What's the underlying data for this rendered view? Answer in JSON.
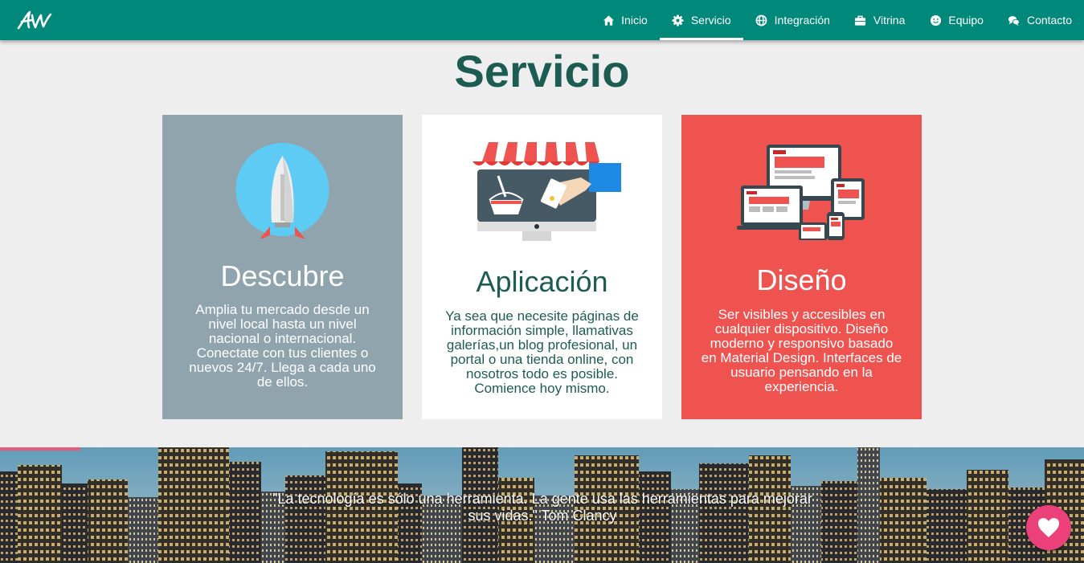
{
  "nav": {
    "items": [
      {
        "label": "Inicio",
        "icon": "home-icon"
      },
      {
        "label": "Servicio",
        "icon": "gear-icon",
        "active": true
      },
      {
        "label": "Integración",
        "icon": "globe-icon"
      },
      {
        "label": "Vitrina",
        "icon": "briefcase-icon"
      },
      {
        "label": "Equipo",
        "icon": "smile-icon"
      },
      {
        "label": "Contacto",
        "icon": "chat-icon"
      }
    ]
  },
  "section": {
    "title": "Servicio"
  },
  "cards": [
    {
      "title": "Descubre",
      "text": "Amplia tu mercado desde un nivel local hasta un nivel nacional o internacional. Conectate con tus clientes o nuevos 24/7. Llega a cada uno de ellos.",
      "illustration": "rocket-illustration"
    },
    {
      "title": "Aplicación",
      "text": "Ya sea que necesite páginas de información simple, llamativas galerías,un blog profesional, un portal o una tienda online, con nosotros todo es posible. Comience hoy mismo.",
      "illustration": "online-store-illustration"
    },
    {
      "title": "Diseño",
      "text": "Ser visibles y accesibles en cualquier dispositivo. Diseño moderno y responsivo basado en Material Design. Interfaces de usuario pensando en la experiencia.",
      "illustration": "responsive-devices-illustration"
    }
  ],
  "banner": {
    "quote": "\"La tecnología es sólo una herramienta. La gente usa las herramientas para mejorar sus vidas.\" Tom Clancy"
  },
  "colors": {
    "navbar": "#00897b",
    "title": "#1d5c53",
    "card1": "#90a4ae",
    "card2": "#ffffff",
    "card3": "#ef5350",
    "fab": "#ec407a"
  }
}
